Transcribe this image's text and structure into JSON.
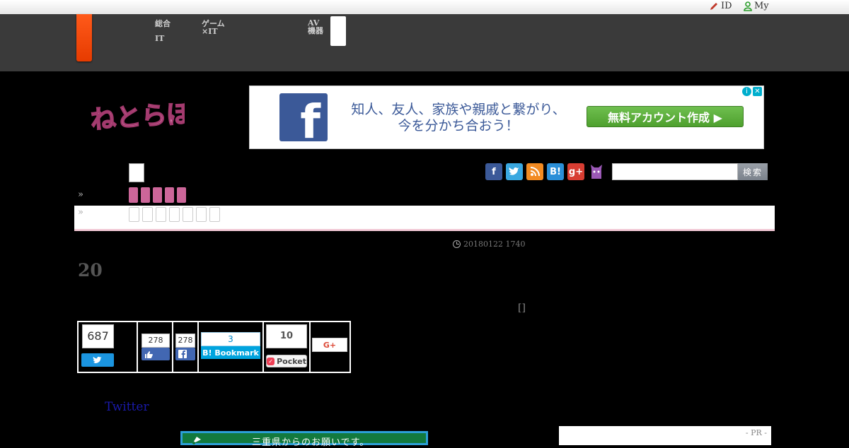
{
  "topbar": {
    "id_label": "ID",
    "my_label": "My"
  },
  "header_nav": {
    "item1a": "総合",
    "item1b": "IT",
    "item2": "ゲーム×IT",
    "item3": "AV機器"
  },
  "logo": {
    "text": "ねとらぼ"
  },
  "ad": {
    "line1": "知人、友人、家族や親戚と繋がり、",
    "line2": "今を分かち合おう！",
    "button": "無料アカウント作成 ▶",
    "fb_letter": "f"
  },
  "social_icons": [
    "facebook-icon",
    "twitter-icon",
    "rss-icon",
    "hatena-icon",
    "googleplus-icon",
    "cat-icon"
  ],
  "site_search": {
    "placeholder": "",
    "button": "検索"
  },
  "breadcrumb_arrows": [
    "»",
    "»"
  ],
  "article": {
    "datetime": "20180122 1740",
    "headline": "20",
    "bracket": "[]"
  },
  "share": {
    "twitter_count": "687",
    "facebook_count_1": "278",
    "facebook_count_2": "278",
    "hatena_count": "3",
    "hatena_label": "B! Bookmark",
    "pocket_count": "10",
    "pocket_label": "Pocket",
    "googleplus_label": "G+"
  },
  "twitter_link": "Twitter",
  "mie_banner": "三重県からのお願いです。",
  "pr_label": "- PR -",
  "colors": {
    "header_bg": "#3a3a3a",
    "accent_orange": "#ff5a1a",
    "facebook_blue": "#3b5998",
    "twitter_blue": "#1b95e0",
    "pink": "#cc6699"
  }
}
